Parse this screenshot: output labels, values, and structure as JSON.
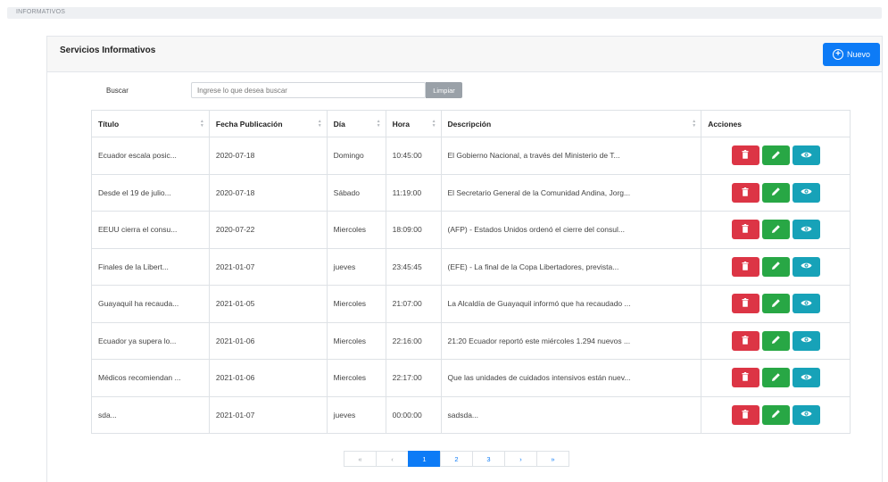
{
  "breadcrumb": "INFORMATIVOS",
  "card": {
    "title": "Servicios Informativos",
    "new_button_label": "Nuevo"
  },
  "search": {
    "label": "Buscar",
    "placeholder": "Ingrese lo que desea buscar",
    "clear_label": "Limpiar"
  },
  "table": {
    "columns": [
      "Título",
      "Fecha Publicación",
      "Día",
      "Hora",
      "Descripción",
      "Acciones"
    ],
    "rows": [
      {
        "titulo": "Ecuador escala posic...",
        "fecha": "2020-07-18",
        "dia": "Domingo",
        "hora": "10:45:00",
        "descripcion": "El Gobierno Nacional, a través del Ministerio de T..."
      },
      {
        "titulo": "Desde el 19 de julio...",
        "fecha": "2020-07-18",
        "dia": "Sábado",
        "hora": "11:19:00",
        "descripcion": "El Secretario General de la Comunidad Andina, Jorg..."
      },
      {
        "titulo": "EEUU cierra el consu...",
        "fecha": "2020-07-22",
        "dia": "Miercoles",
        "hora": "18:09:00",
        "descripcion": "(AFP) - Estados Unidos ordenó el cierre del consul..."
      },
      {
        "titulo": "Finales de la Libert...",
        "fecha": "2021-01-07",
        "dia": "jueves",
        "hora": "23:45:45",
        "descripcion": "(EFE) - La final de la Copa Libertadores, prevista..."
      },
      {
        "titulo": "Guayaquil ha recauda...",
        "fecha": "2021-01-05",
        "dia": "Miercoles",
        "hora": "21:07:00",
        "descripcion": "La Alcaldía de Guayaquil informó que ha recaudado ..."
      },
      {
        "titulo": "Ecuador ya supera lo...",
        "fecha": "2021-01-06",
        "dia": "Miercoles",
        "hora": "22:16:00",
        "descripcion": "21:20 Ecuador reportó este miércoles 1.294 nuevos ..."
      },
      {
        "titulo": "Médicos recomiendan ...",
        "fecha": "2021-01-06",
        "dia": "Miercoles",
        "hora": "22:17:00",
        "descripcion": "Que las unidades de cuidados intensivos están nuev..."
      },
      {
        "titulo": "sda...",
        "fecha": "2021-01-07",
        "dia": "jueves",
        "hora": "00:00:00",
        "descripcion": "sadsda..."
      }
    ]
  },
  "pagination": {
    "items": [
      {
        "label": "«",
        "state": "muted"
      },
      {
        "label": "‹",
        "state": "muted"
      },
      {
        "label": "1",
        "state": "active"
      },
      {
        "label": "2",
        "state": "normal"
      },
      {
        "label": "3",
        "state": "normal"
      },
      {
        "label": "›",
        "state": "normal"
      },
      {
        "label": "»",
        "state": "normal"
      }
    ]
  },
  "colors": {
    "primary": "#0d7bf6",
    "danger": "#dc3545",
    "success": "#28a745",
    "info": "#17a2b8"
  },
  "icons": {
    "new": "plus-circle-icon",
    "delete": "trash-icon",
    "edit": "pencil-icon",
    "view": "eye-icon",
    "sort": "sort-icon"
  }
}
